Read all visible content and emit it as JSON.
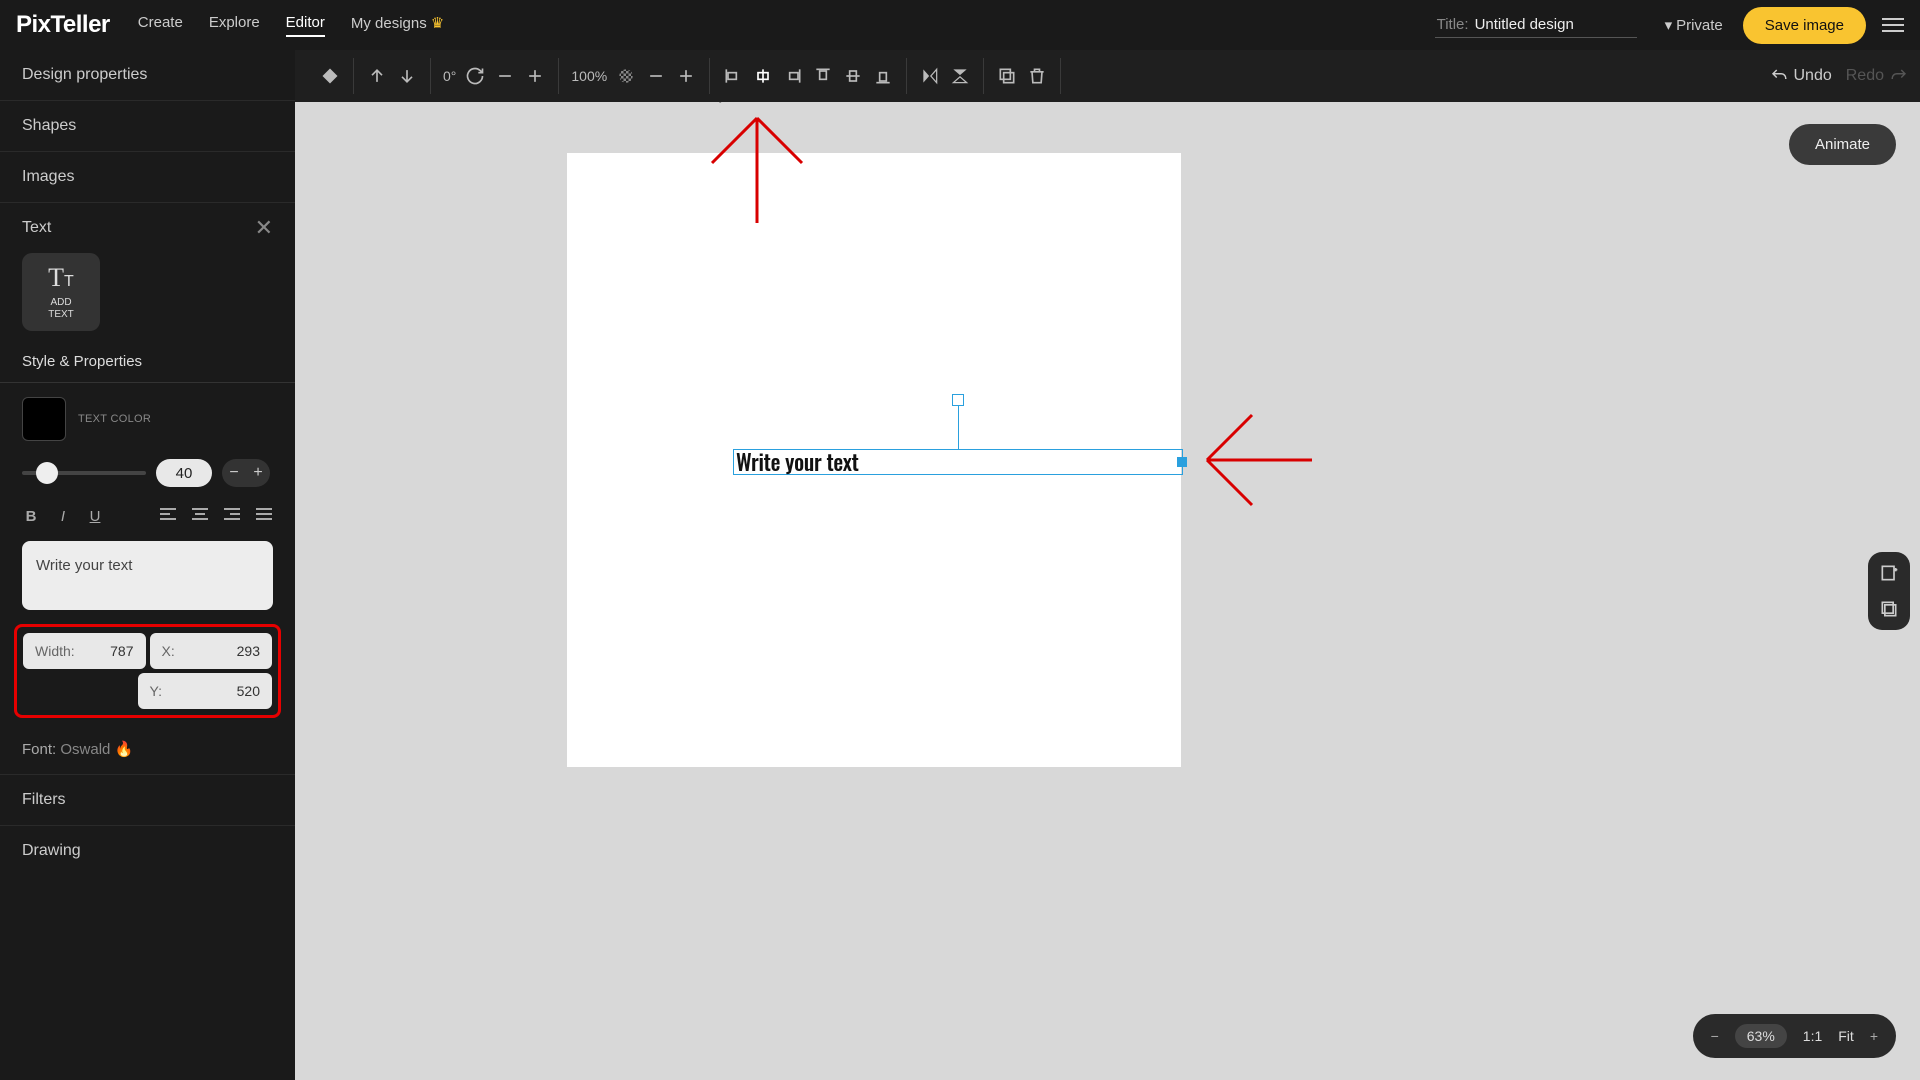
{
  "nav": {
    "logo": "PixTeller",
    "links": {
      "create": "Create",
      "explore": "Explore",
      "editor": "Editor",
      "mydesigns": "My designs"
    },
    "title_label": "Title:",
    "title_value": "Untitled design",
    "private": "Private",
    "save": "Save image"
  },
  "toolbar": {
    "rotate_deg": "0°",
    "opacity": "100%",
    "undo": "Undo",
    "redo": "Redo"
  },
  "sidebar": {
    "design_props": "Design properties",
    "shapes": "Shapes",
    "images": "Images",
    "text": "Text",
    "add_text": "ADD\nTEXT",
    "style_props": "Style & Properties",
    "text_color": "TEXT COLOR",
    "font_size": "40",
    "text_content": "Write your text",
    "width_label": "Width:",
    "width_val": "787",
    "x_label": "X:",
    "x_val": "293",
    "y_label": "Y:",
    "y_val": "520",
    "font_label": "Font:",
    "font_name": "Oswald",
    "filters": "Filters",
    "drawing": "Drawing"
  },
  "canvas": {
    "text": "Write your text",
    "animate": "Animate"
  },
  "zoom": {
    "pct": "63%",
    "ratio": "1:1",
    "fit": "Fit"
  }
}
